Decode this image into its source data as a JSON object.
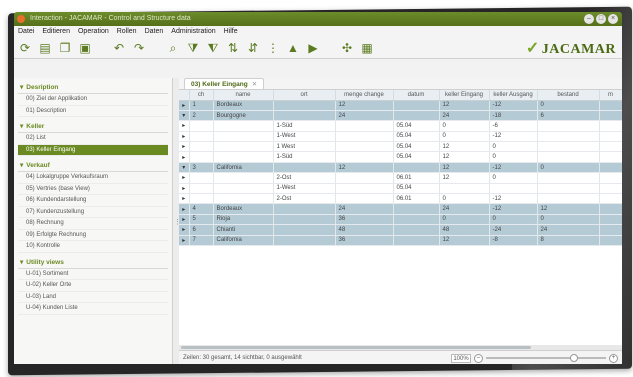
{
  "window": {
    "title": "Interaction - JACAMAR - Control and Structure data"
  },
  "menu": [
    "Datei",
    "Editieren",
    "Operation",
    "Rollen",
    "Daten",
    "Administration",
    "Hilfe"
  ],
  "toolbar": {
    "icons": [
      "refresh-icon",
      "save-icon",
      "copy-icon",
      "paste-icon",
      "undo-icon",
      "redo-icon",
      "search-icon",
      "filter-icon",
      "filter-clear-icon",
      "sort-asc-icon",
      "sort-desc-icon",
      "group-icon",
      "arrow-up-icon",
      "arrow-down-icon",
      "expand-icon",
      "grid-icon"
    ]
  },
  "logo": {
    "text": "JACAMAR"
  },
  "sidebar": {
    "sections": [
      {
        "title": "Desription",
        "items": [
          {
            "label": "00) Ziel der Applikation"
          },
          {
            "label": "01) Description"
          }
        ]
      },
      {
        "title": "Keller",
        "items": [
          {
            "label": "02) List"
          },
          {
            "label": "03) Keller Eingang",
            "active": true
          }
        ]
      },
      {
        "title": "Verkauf",
        "items": [
          {
            "label": "04) Lokalgruppe Verkaufsraum"
          },
          {
            "label": "05) Vertries (base View)"
          },
          {
            "label": "06) Kundendarstellung"
          },
          {
            "label": "07) Kundenzustellung"
          },
          {
            "label": "08) Rechnung"
          },
          {
            "label": "09) Erfolgte Rechnung"
          },
          {
            "label": "10) Kontrolle"
          }
        ]
      },
      {
        "title": "Utility views",
        "items": [
          {
            "label": "U-01) Sortiment"
          },
          {
            "label": "U-02) Keller Orte"
          },
          {
            "label": "U-03) Land"
          },
          {
            "label": "U-04) Kunden Liste"
          }
        ]
      }
    ]
  },
  "tab": {
    "label": "03) Keller Eingang"
  },
  "table": {
    "columns": [
      "",
      "ch",
      "name",
      "ort",
      "menge change",
      "datum",
      "keller Eingang",
      "keller Ausgang",
      "bestand",
      "m"
    ],
    "rows": [
      {
        "level": 0,
        "expander": "▸",
        "cells": [
          "1",
          "Bordeaux",
          "",
          "12",
          "",
          "12",
          "-12",
          "0",
          ""
        ]
      },
      {
        "level": 0,
        "expander": "▾",
        "cells": [
          "2",
          "Bourgogne",
          "",
          "24",
          "",
          "24",
          "-18",
          "6",
          ""
        ]
      },
      {
        "level": 1,
        "expander": "▸",
        "cells": [
          "",
          "",
          "1-Süd",
          "",
          "05.04",
          "0",
          "-6",
          "",
          ""
        ]
      },
      {
        "level": 1,
        "expander": "▸",
        "cells": [
          "",
          "",
          "1-West",
          "",
          "05.04",
          "0",
          "-12",
          "",
          ""
        ]
      },
      {
        "level": 1,
        "expander": "▸",
        "cells": [
          "",
          "",
          "1 West",
          "",
          "05.04",
          "12",
          "0",
          "",
          ""
        ]
      },
      {
        "level": 1,
        "expander": "▸",
        "cells": [
          "",
          "",
          "1-Süd",
          "",
          "05.04",
          "12",
          "0",
          "",
          ""
        ]
      },
      {
        "level": 0,
        "expander": "▾",
        "cells": [
          "3",
          "California",
          "",
          "12",
          "",
          "12",
          "-12",
          "0",
          ""
        ]
      },
      {
        "level": 1,
        "expander": "▸",
        "cells": [
          "",
          "",
          "2-Ost",
          "",
          "06.01",
          "12",
          "0",
          "",
          ""
        ]
      },
      {
        "level": 1,
        "expander": "▸",
        "cells": [
          "",
          "",
          "1-West",
          "",
          "05.04",
          "",
          "",
          "",
          ""
        ]
      },
      {
        "level": 1,
        "expander": "▸",
        "cells": [
          "",
          "",
          "2-Ost",
          "",
          "06.01",
          "0",
          "-12",
          "",
          ""
        ]
      },
      {
        "level": 0,
        "expander": "▸",
        "cells": [
          "4",
          "Bordeaux",
          "",
          "24",
          "",
          "24",
          "-12",
          "12",
          ""
        ]
      },
      {
        "level": 0,
        "expander": "▸",
        "cells": [
          "5",
          "Rioja",
          "",
          "36",
          "",
          "0",
          "0",
          "0",
          ""
        ]
      },
      {
        "level": 0,
        "expander": "▸",
        "cells": [
          "6",
          "Chianti",
          "",
          "48",
          "",
          "48",
          "-24",
          "24",
          ""
        ]
      },
      {
        "level": 0,
        "expander": "▸",
        "cells": [
          "7",
          "California",
          "",
          "36",
          "",
          "12",
          "-8",
          "8",
          ""
        ]
      }
    ]
  },
  "status": {
    "text": "Zeilen: 30 gesamt, 14 sichtbar, 0 ausgewählt",
    "zoom": "100%",
    "zoom_level": 0.75
  }
}
